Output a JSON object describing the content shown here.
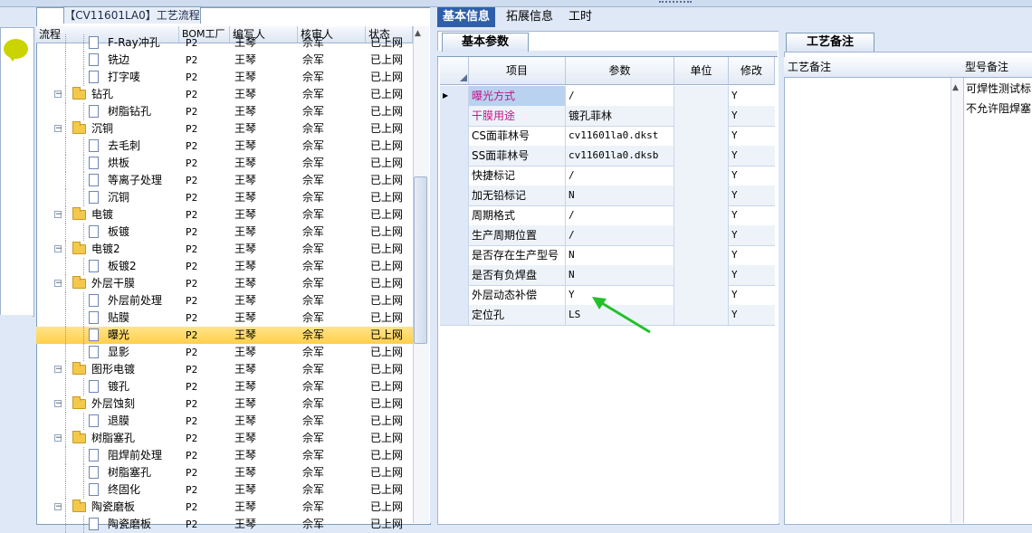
{
  "tree_panel": {
    "title": "【CV11601LA0】工艺流程",
    "columns": [
      "流程",
      "BOM工厂",
      "编写人",
      "核审人",
      "状态"
    ],
    "rows": [
      {
        "label": "F-Ray冲孔",
        "level": 2,
        "type": "doc",
        "bom": "P2",
        "writer": "王琴",
        "reviewer": "佘军",
        "status": "已上网"
      },
      {
        "label": "铣边",
        "level": 2,
        "type": "doc",
        "bom": "P2",
        "writer": "王琴",
        "reviewer": "佘军",
        "status": "已上网"
      },
      {
        "label": "打字唛",
        "level": 2,
        "type": "doc",
        "bom": "P2",
        "writer": "王琴",
        "reviewer": "佘军",
        "status": "已上网"
      },
      {
        "label": "钻孔",
        "level": 1,
        "type": "folder",
        "bom": "P2",
        "writer": "王琴",
        "reviewer": "佘军",
        "status": "已上网"
      },
      {
        "label": "树脂钻孔",
        "level": 2,
        "type": "doc",
        "bom": "P2",
        "writer": "王琴",
        "reviewer": "佘军",
        "status": "已上网"
      },
      {
        "label": "沉铜",
        "level": 1,
        "type": "folder",
        "bom": "P2",
        "writer": "王琴",
        "reviewer": "佘军",
        "status": "已上网"
      },
      {
        "label": "去毛刺",
        "level": 2,
        "type": "doc",
        "bom": "P2",
        "writer": "王琴",
        "reviewer": "佘军",
        "status": "已上网"
      },
      {
        "label": "烘板",
        "level": 2,
        "type": "doc",
        "bom": "P2",
        "writer": "王琴",
        "reviewer": "佘军",
        "status": "已上网"
      },
      {
        "label": "等离子处理",
        "level": 2,
        "type": "doc",
        "bom": "P2",
        "writer": "王琴",
        "reviewer": "佘军",
        "status": "已上网"
      },
      {
        "label": "沉铜",
        "level": 2,
        "type": "doc",
        "bom": "P2",
        "writer": "王琴",
        "reviewer": "佘军",
        "status": "已上网"
      },
      {
        "label": "电镀",
        "level": 1,
        "type": "folder",
        "bom": "P2",
        "writer": "王琴",
        "reviewer": "佘军",
        "status": "已上网"
      },
      {
        "label": "板镀",
        "level": 2,
        "type": "doc",
        "bom": "P2",
        "writer": "王琴",
        "reviewer": "佘军",
        "status": "已上网"
      },
      {
        "label": "电镀2",
        "level": 1,
        "type": "folder",
        "bom": "P2",
        "writer": "王琴",
        "reviewer": "佘军",
        "status": "已上网"
      },
      {
        "label": "板镀2",
        "level": 2,
        "type": "doc",
        "bom": "P2",
        "writer": "王琴",
        "reviewer": "佘军",
        "status": "已上网"
      },
      {
        "label": "外层干膜",
        "level": 1,
        "type": "folder",
        "bom": "P2",
        "writer": "王琴",
        "reviewer": "佘军",
        "status": "已上网"
      },
      {
        "label": "外层前处理",
        "level": 2,
        "type": "doc",
        "bom": "P2",
        "writer": "王琴",
        "reviewer": "佘军",
        "status": "已上网"
      },
      {
        "label": "贴膜",
        "level": 2,
        "type": "doc",
        "bom": "P2",
        "writer": "王琴",
        "reviewer": "佘军",
        "status": "已上网"
      },
      {
        "label": "曝光",
        "level": 2,
        "type": "doc",
        "bom": "P2",
        "writer": "王琴",
        "reviewer": "佘军",
        "status": "已上网",
        "selected": true
      },
      {
        "label": "显影",
        "level": 2,
        "type": "doc",
        "bom": "P2",
        "writer": "王琴",
        "reviewer": "佘军",
        "status": "已上网"
      },
      {
        "label": "图形电镀",
        "level": 1,
        "type": "folder",
        "bom": "P2",
        "writer": "王琴",
        "reviewer": "佘军",
        "status": "已上网"
      },
      {
        "label": "镀孔",
        "level": 2,
        "type": "doc",
        "bom": "P2",
        "writer": "王琴",
        "reviewer": "佘军",
        "status": "已上网"
      },
      {
        "label": "外层蚀刻",
        "level": 1,
        "type": "folder",
        "bom": "P2",
        "writer": "王琴",
        "reviewer": "佘军",
        "status": "已上网"
      },
      {
        "label": "退膜",
        "level": 2,
        "type": "doc",
        "bom": "P2",
        "writer": "王琴",
        "reviewer": "佘军",
        "status": "已上网"
      },
      {
        "label": "树脂塞孔",
        "level": 1,
        "type": "folder",
        "bom": "P2",
        "writer": "王琴",
        "reviewer": "佘军",
        "status": "已上网"
      },
      {
        "label": "阻焊前处理",
        "level": 2,
        "type": "doc",
        "bom": "P2",
        "writer": "王琴",
        "reviewer": "佘军",
        "status": "已上网"
      },
      {
        "label": "树脂塞孔",
        "level": 2,
        "type": "doc",
        "bom": "P2",
        "writer": "王琴",
        "reviewer": "佘军",
        "status": "已上网"
      },
      {
        "label": "终固化",
        "level": 2,
        "type": "doc",
        "bom": "P2",
        "writer": "王琴",
        "reviewer": "佘军",
        "status": "已上网"
      },
      {
        "label": "陶瓷磨板",
        "level": 1,
        "type": "folder",
        "bom": "P2",
        "writer": "王琴",
        "reviewer": "佘军",
        "status": "已上网"
      },
      {
        "label": "陶瓷磨板",
        "level": 2,
        "type": "doc",
        "bom": "P2",
        "writer": "王琴",
        "reviewer": "佘军",
        "status": "已上网"
      }
    ]
  },
  "main_tabs": [
    {
      "label": "基本信息",
      "active": true
    },
    {
      "label": "拓展信息",
      "active": false
    },
    {
      "label": "工时",
      "active": false
    }
  ],
  "params_panel": {
    "subtab": "基本参数",
    "columns": [
      "项目",
      "参数",
      "单位",
      "修改"
    ],
    "rows": [
      {
        "item": "曝光方式",
        "value": "/",
        "unit": "",
        "modify": "Y",
        "color": "#c0168a",
        "current": true
      },
      {
        "item": "干膜用途",
        "value": "镀孔菲林",
        "unit": "",
        "modify": "Y",
        "color": "#c0168a"
      },
      {
        "item": "CS面菲林号",
        "value": "cv11601la0.dkst",
        "unit": "",
        "modify": "Y"
      },
      {
        "item": "SS面菲林号",
        "value": "cv11601la0.dksb",
        "unit": "",
        "modify": "Y"
      },
      {
        "item": "快捷标记",
        "value": "/",
        "unit": "",
        "modify": "Y"
      },
      {
        "item": "加无铅标记",
        "value": "N",
        "unit": "",
        "modify": "Y"
      },
      {
        "item": "周期格式",
        "value": "/",
        "unit": "",
        "modify": "Y"
      },
      {
        "item": "生产周期位置",
        "value": "/",
        "unit": "",
        "modify": "Y"
      },
      {
        "item": "是否存在生产型号",
        "value": "N",
        "unit": "",
        "modify": "Y"
      },
      {
        "item": "是否有负焊盘",
        "value": "N",
        "unit": "",
        "modify": "Y"
      },
      {
        "item": "外层动态补偿",
        "value": "Y",
        "unit": "",
        "modify": "Y"
      },
      {
        "item": "定位孔",
        "value": "LS",
        "unit": "",
        "modify": "Y"
      }
    ]
  },
  "notes_panel": {
    "subtab": "工艺备注",
    "col1": "工艺备注",
    "col2": "型号备注",
    "model_notes": [
      "可焊性测试标",
      "不允许阻焊塞"
    ]
  },
  "colors": {
    "accent": "#2f5faa",
    "highlight": "#ffcf4a",
    "magenta": "#c0168a",
    "arrow": "#22c12a"
  }
}
